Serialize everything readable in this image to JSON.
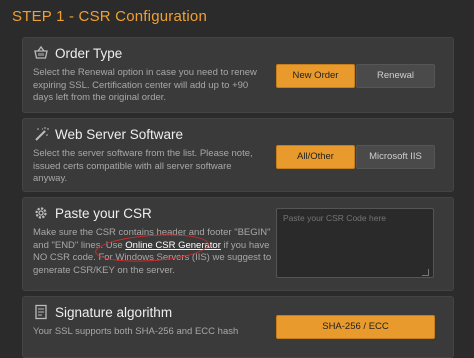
{
  "page": {
    "title": "STEP 1 - CSR Configuration"
  },
  "order_type": {
    "title": "Order Type",
    "desc": "Select the Renewal option in case you need to renew expiring SSL. Certification center will add up to +90 days left from the original order.",
    "buttons": [
      {
        "label": "New Order",
        "active": true
      },
      {
        "label": "Renewal",
        "active": false
      }
    ]
  },
  "server_software": {
    "title": "Web Server Software",
    "desc": "Select the server software from the list. Please note, issued certs compatible with all server software anyway.",
    "buttons": [
      {
        "label": "All/Other",
        "active": true
      },
      {
        "label": "Microsoft IIS",
        "active": false
      }
    ]
  },
  "paste_csr": {
    "title": "Paste your CSR",
    "desc_before": "Make sure the CSR contains header and footer \"BEGIN\" and \"END\" lines. Use ",
    "link": "Online CSR Generator",
    "desc_after": " if you have NO CSR code. For Windows Servers (IIS) we suggest to generate CSR/KEY on the server.",
    "placeholder": "Paste your CSR Code here"
  },
  "signature": {
    "title": "Signature algorithm",
    "desc": "Your SSL supports both SHA-256 and ECC hash",
    "button": "SHA-256 / ECC"
  },
  "colors": {
    "accent": "#e89a2c",
    "title": "#f0a030",
    "panel": "#3a3a3a",
    "annotation": "#d02a2a"
  }
}
